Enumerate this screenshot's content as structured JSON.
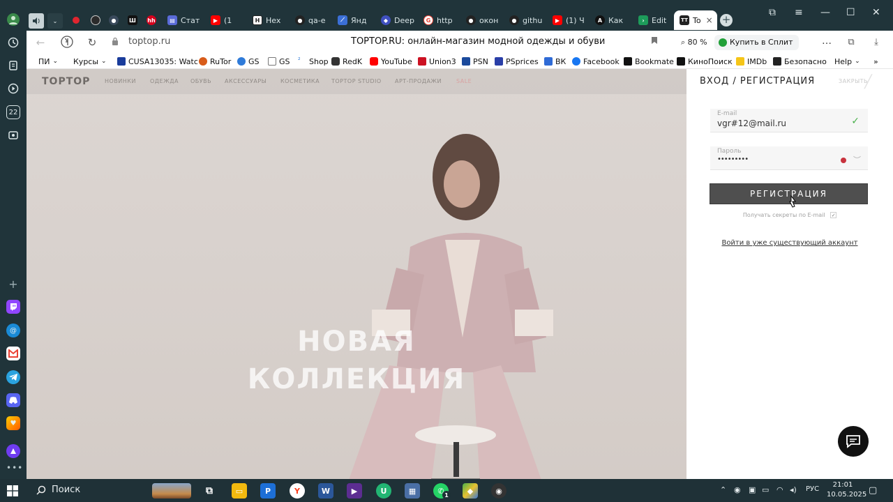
{
  "browser": {
    "tabs": [
      {
        "label": "",
        "icon": "speaker-icon",
        "color": "#c8d3d6"
      },
      {
        "label": "",
        "icon": "chevron-down-icon",
        "color": "#2a3f45"
      },
      {
        "label": "",
        "icon": "red-circle-icon",
        "color": "#e0252f"
      },
      {
        "label": "",
        "icon": "gear-circle-icon",
        "color": "#2b2b2b"
      },
      {
        "label": "",
        "icon": "steam-icon",
        "color": "#3a4a5c"
      },
      {
        "label": "",
        "icon": "hh-icon",
        "color": "#111111"
      },
      {
        "label": "",
        "icon": "hh-red-icon",
        "color": "#d6001c"
      },
      {
        "label": "Стат",
        "icon": "discord-like-icon",
        "color": "#5a6bd8"
      },
      {
        "label": "(1",
        "icon": "youtube-icon",
        "color": "#ff0000"
      },
      {
        "label": "Hex",
        "icon": "h-icon",
        "color": "#3a5ad0"
      },
      {
        "label": "qa-e",
        "icon": "github-icon",
        "color": "#222222"
      },
      {
        "label": "Янд",
        "icon": "yandex-icon",
        "color": "#3b6fd6"
      },
      {
        "label": "Deep",
        "icon": "deepl-icon",
        "color": "#4050c0"
      },
      {
        "label": "http",
        "icon": "google-icon",
        "color": "#ea4335"
      },
      {
        "label": "окон",
        "icon": "github-icon",
        "color": "#222222"
      },
      {
        "label": "githu",
        "icon": "github-icon",
        "color": "#222222"
      },
      {
        "label": "(1) Ч",
        "icon": "youtube-icon",
        "color": "#ff0000"
      },
      {
        "label": "Как",
        "icon": "a-icon",
        "color": "#111111"
      },
      {
        "label": "Edit",
        "icon": "edit-icon",
        "color": "#1d9b5a"
      },
      {
        "label": "To",
        "icon": "tt-icon",
        "color": "#222222"
      }
    ],
    "active_tab_close": "×",
    "address": {
      "url": "toptop.ru",
      "title": "TOPTOP.RU: онлайн-магазин модной одежды и обуви",
      "zoom": "80 %",
      "split_label": "Купить в Сплит"
    },
    "bookmarks": [
      {
        "label": "ПИ",
        "dropdown": true,
        "color": "#ffffff"
      },
      {
        "label": "Курсы",
        "dropdown": true,
        "color": "#ffffff"
      },
      {
        "label": "CUSA13035: Watc",
        "color": "#1a3c9b"
      },
      {
        "label": "RuTor",
        "color": "#d85c1a"
      },
      {
        "label": "GS",
        "color": "#2f7bd9"
      },
      {
        "label": "GS",
        "color": "#e5e5e5"
      },
      {
        "label": "Shop",
        "color": "#2f7bd9"
      },
      {
        "label": "RedK",
        "color": "#333333"
      },
      {
        "label": "YouTube",
        "color": "#ff0000"
      },
      {
        "label": "Union3",
        "color": "#cc1122"
      },
      {
        "label": "PSN",
        "color": "#1b4a9c"
      },
      {
        "label": "PSprices",
        "color": "#2a3fa8"
      },
      {
        "label": "ВК",
        "color": "#2f6bd6"
      },
      {
        "label": "Facebook",
        "color": "#1877f2"
      },
      {
        "label": "Bookmate",
        "color": "#111111"
      },
      {
        "label": "КиноПоиск",
        "color": "#111111"
      },
      {
        "label": "IMDb",
        "color": "#f5c518"
      },
      {
        "label": "Безопасно",
        "color": "#222222"
      },
      {
        "label": "Help",
        "dropdown": true,
        "color": "#ffffff"
      }
    ],
    "side_counter": "22"
  },
  "site": {
    "logo": "TOPTOP",
    "menu": [
      "НОВИНКИ",
      "ОДЕЖДА",
      "ОБУВЬ",
      "АКСЕССУАРЫ",
      "КОСМЕТИКА",
      "TOPTOP STUDIO",
      "АРТ-ПРОДАЖИ",
      "SALE"
    ],
    "hero_title_line1": "НОВАЯ",
    "hero_title_line2": "КОЛЛЕКЦИЯ"
  },
  "auth": {
    "title": "ВХОД / РЕГИСТРАЦИЯ",
    "close_label": "ЗАКРЫТЬ",
    "email_label": "E-mail",
    "email_value": "vgr#12@mail.ru",
    "password_label": "Пароль",
    "password_value": "•••••••••",
    "register_button": "РЕГИСТРАЦИЯ",
    "subscribe_label": "Получать секреты по E-mail",
    "login_link": "Войти в уже существующий аккаунт"
  },
  "taskbar": {
    "search_label": "Поиск",
    "language": "РУС",
    "time": "21:01",
    "date": "10.05.2025",
    "whatsapp_badge": "1"
  }
}
